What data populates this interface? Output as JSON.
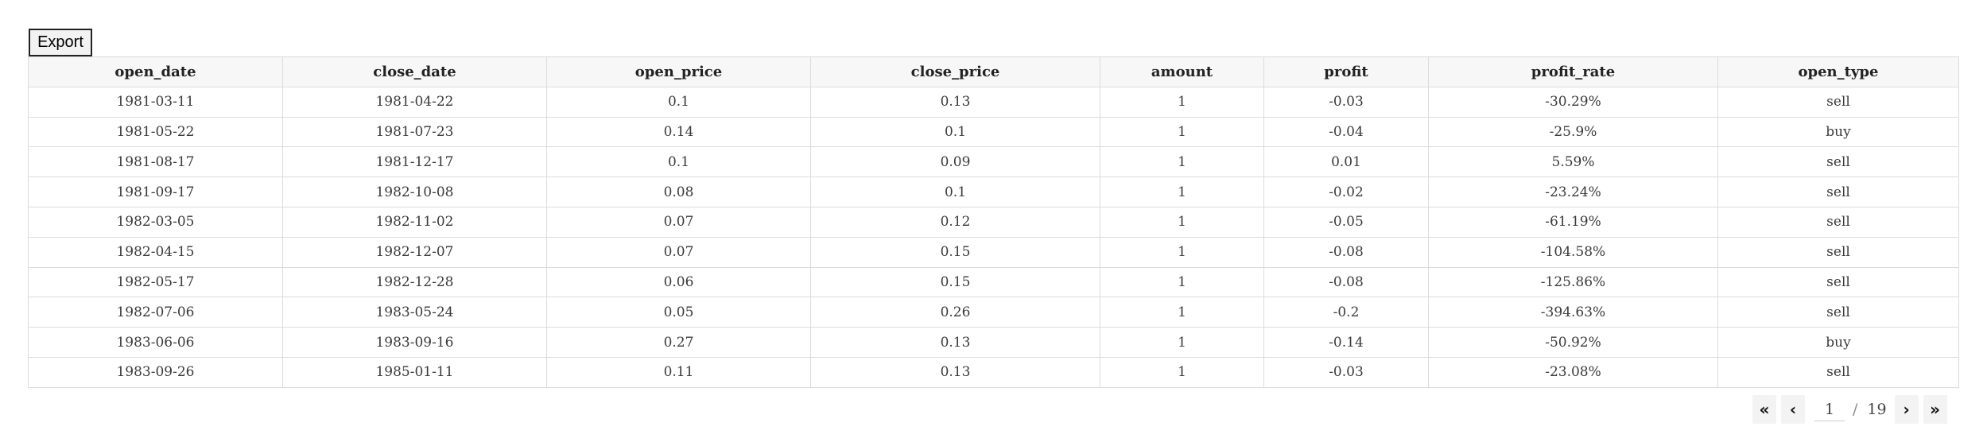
{
  "toolbar": {
    "export_label": "Export"
  },
  "table": {
    "columns": [
      "open_date",
      "close_date",
      "open_price",
      "close_price",
      "amount",
      "profit",
      "profit_rate",
      "open_type"
    ],
    "rows": [
      [
        "1981-03-11",
        "1981-04-22",
        "0.1",
        "0.13",
        "1",
        "-0.03",
        "-30.29%",
        "sell"
      ],
      [
        "1981-05-22",
        "1981-07-23",
        "0.14",
        "0.1",
        "1",
        "-0.04",
        "-25.9%",
        "buy"
      ],
      [
        "1981-08-17",
        "1981-12-17",
        "0.1",
        "0.09",
        "1",
        "0.01",
        "5.59%",
        "sell"
      ],
      [
        "1981-09-17",
        "1982-10-08",
        "0.08",
        "0.1",
        "1",
        "-0.02",
        "-23.24%",
        "sell"
      ],
      [
        "1982-03-05",
        "1982-11-02",
        "0.07",
        "0.12",
        "1",
        "-0.05",
        "-61.19%",
        "sell"
      ],
      [
        "1982-04-15",
        "1982-12-07",
        "0.07",
        "0.15",
        "1",
        "-0.08",
        "-104.58%",
        "sell"
      ],
      [
        "1982-05-17",
        "1982-12-28",
        "0.06",
        "0.15",
        "1",
        "-0.08",
        "-125.86%",
        "sell"
      ],
      [
        "1982-07-06",
        "1983-05-24",
        "0.05",
        "0.26",
        "1",
        "-0.2",
        "-394.63%",
        "sell"
      ],
      [
        "1983-06-06",
        "1983-09-16",
        "0.27",
        "0.13",
        "1",
        "-0.14",
        "-50.92%",
        "buy"
      ],
      [
        "1983-09-26",
        "1985-01-11",
        "0.11",
        "0.13",
        "1",
        "-0.03",
        "-23.08%",
        "sell"
      ]
    ]
  },
  "pagination": {
    "current_page": "1",
    "separator": "/",
    "total_pages": "19",
    "first_icon": "«",
    "prev_icon": "‹",
    "next_icon": "›",
    "last_icon": "»"
  }
}
